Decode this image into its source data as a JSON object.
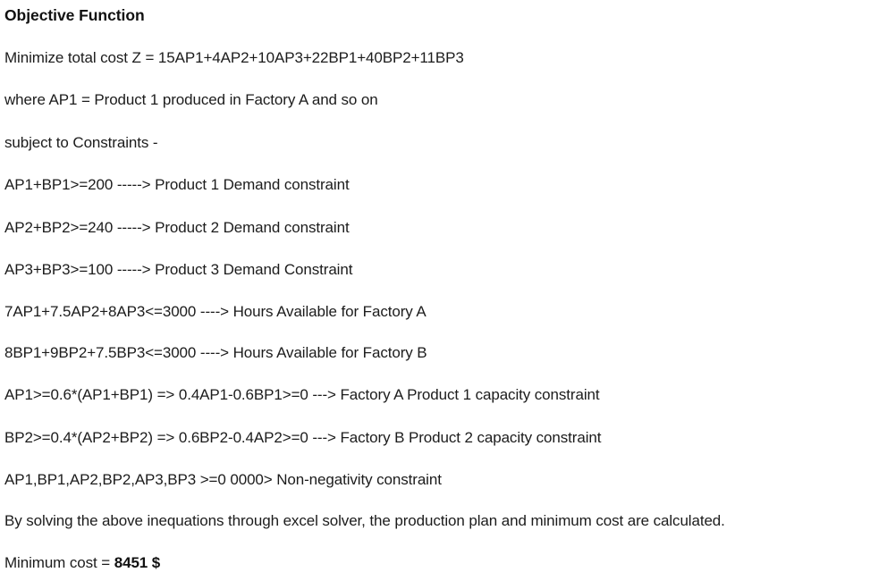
{
  "document": {
    "heading": "Objective Function",
    "background_color": "#ffffff",
    "text_color": "#1c1c1c",
    "lines": [
      {
        "id": "objective",
        "text": "Minimize total cost Z = 15AP1+4AP2+10AP3+22BP1+40BP2+11BP3"
      },
      {
        "id": "legend",
        "text": "where AP1 = Product 1 produced in Factory A and so on"
      },
      {
        "id": "constraints-label",
        "text": "subject to Constraints -"
      },
      {
        "id": "demand-product-1",
        "text": "AP1+BP1>=200 -----> Product 1 Demand constraint"
      },
      {
        "id": "demand-product-2",
        "text": "AP2+BP2>=240 -----> Product 2 Demand constraint"
      },
      {
        "id": "demand-product-3",
        "text": "AP3+BP3>=100 -----> Product 3 Demand Constraint"
      },
      {
        "id": "hours-factory-a",
        "text": "7AP1+7.5AP2+8AP3<=3000 ----> Hours Available for Factory A"
      },
      {
        "id": "hours-factory-b",
        "text": "8BP1+9BP2+7.5BP3<=3000 ----> Hours Available for Factory B"
      },
      {
        "id": "capacity-factory-a-product-1",
        "text": "AP1>=0.6*(AP1+BP1) => 0.4AP1-0.6BP1>=0 ---> Factory A Product 1 capacity constraint"
      },
      {
        "id": "capacity-factory-b-product-2",
        "text": "BP2>=0.4*(AP2+BP2) => 0.6BP2-0.4AP2>=0 ---> Factory B Product 2 capacity constraint"
      },
      {
        "id": "non-negativity",
        "text": "AP1,BP1,AP2,BP2,AP3,BP3 >=0 0000> Non-negativity constraint"
      },
      {
        "id": "solver-note",
        "text": "By solving the above inequations through excel solver, the production plan and minimum cost are calculated."
      }
    ],
    "result": {
      "label": "Minimum cost = ",
      "value": "8451 $"
    }
  }
}
